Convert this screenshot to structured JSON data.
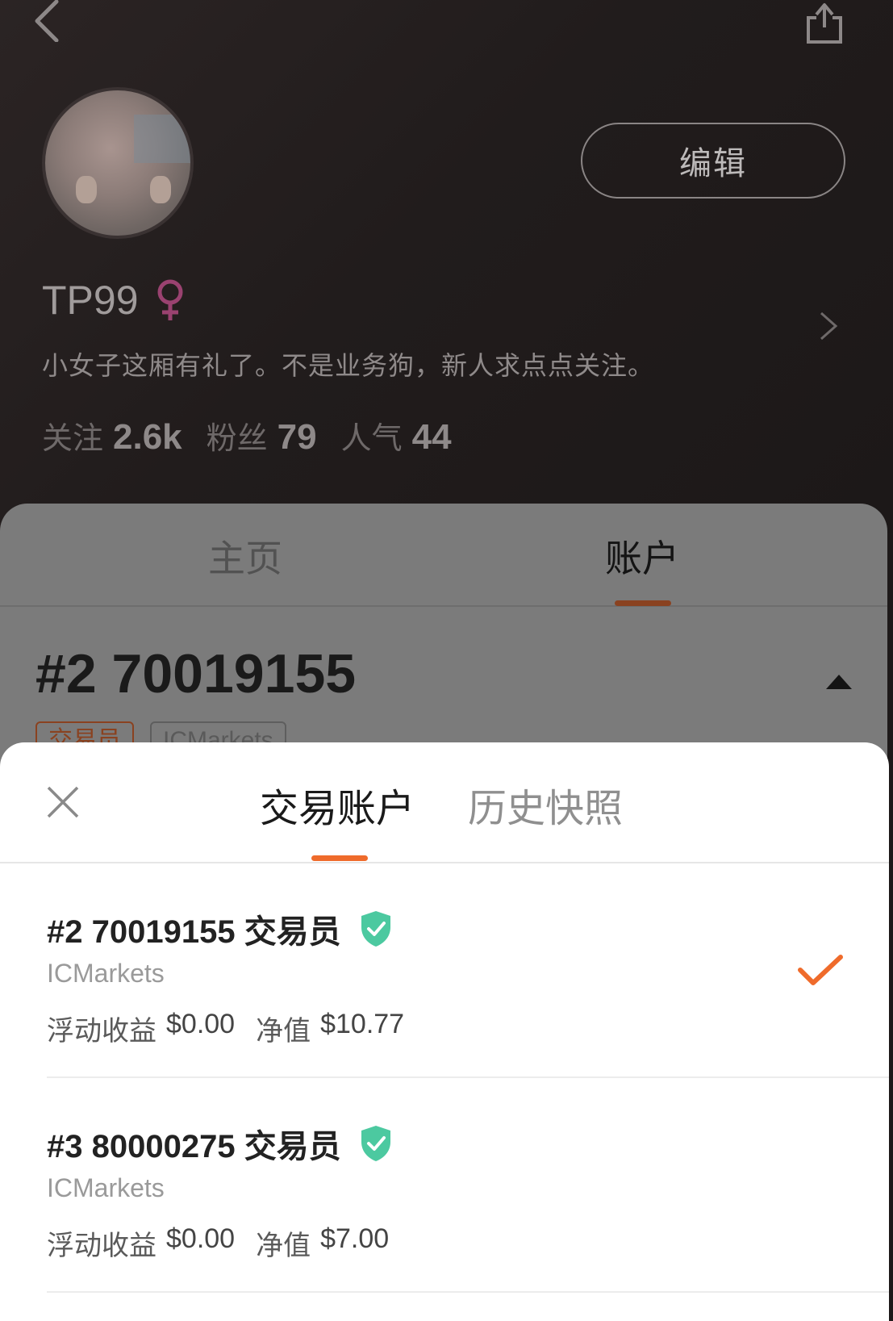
{
  "profile": {
    "username": "TP99",
    "bio": "小女子这厢有礼了。不是业务狗，新人求点点关注。",
    "edit_label": "编辑",
    "stats": [
      {
        "label": "关注",
        "value": "2.6k"
      },
      {
        "label": "粉丝",
        "value": "79"
      },
      {
        "label": "人气",
        "value": "44"
      }
    ]
  },
  "page": {
    "tabs": [
      "主页",
      "账户"
    ],
    "active_tab": "账户",
    "account_title": "#2 70019155",
    "badges": [
      "交易员",
      "ICMarkets"
    ]
  },
  "sheet": {
    "tabs": [
      "交易账户",
      "历史快照"
    ],
    "active_tab": "交易账户",
    "accounts": [
      {
        "title": "#2 70019155 交易员",
        "broker": "ICMarkets",
        "float_label": "浮动收益",
        "float_value": "$0.00",
        "equity_label": "净值",
        "equity_value": "$10.77",
        "selected": true
      },
      {
        "title": "#3 80000275 交易员",
        "broker": "ICMarkets",
        "float_label": "浮动收益",
        "float_value": "$0.00",
        "equity_label": "净值",
        "equity_value": "$7.00",
        "selected": false
      }
    ]
  },
  "colors": {
    "accent": "#ef6b2b",
    "verified": "#4cc9a0",
    "gender": "#e0449a"
  },
  "icons": [
    "back-icon",
    "share-icon",
    "female-icon",
    "chevron-right-icon",
    "caret-up-icon",
    "close-icon",
    "shield-check-icon",
    "checkmark-icon"
  ]
}
